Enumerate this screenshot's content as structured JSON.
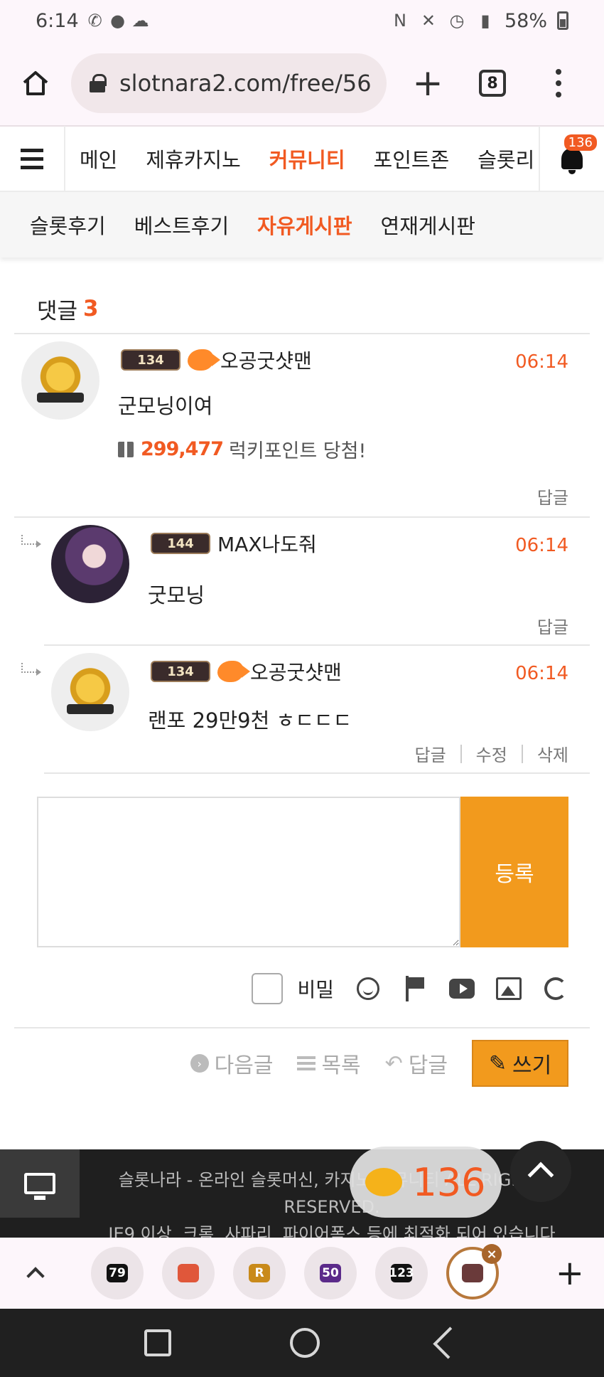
{
  "status_bar": {
    "time": "6:14",
    "battery": "58%"
  },
  "browser": {
    "url": "slotnara2.com/free/56",
    "tab_count": "8"
  },
  "site_nav": {
    "items": [
      {
        "label": "메인",
        "active": false
      },
      {
        "label": "제휴카지노",
        "active": false
      },
      {
        "label": "커뮤니티",
        "active": true
      },
      {
        "label": "포인트존",
        "active": false
      },
      {
        "label": "슬롯리",
        "active": false
      }
    ],
    "notification_count": "136"
  },
  "sub_nav": {
    "items": [
      {
        "label": "슬롯후기",
        "active": false
      },
      {
        "label": "베스트후기",
        "active": false
      },
      {
        "label": "자유게시판",
        "active": true
      },
      {
        "label": "연재게시판",
        "active": false
      }
    ]
  },
  "comments_section": {
    "title": "댓글",
    "count": "3",
    "comments": [
      {
        "level": "134",
        "username": "오공굿샷맨",
        "time": "06:14",
        "text": "군모닝이여",
        "lucky_points": "299,477",
        "lucky_suffix": "럭키포인트 당첨!",
        "reply_label": "답글"
      },
      {
        "level": "144",
        "username": "MAX나도줘",
        "time": "06:14",
        "text": "굿모닝",
        "reply_label": "답글"
      },
      {
        "level": "134",
        "username": "오공굿샷맨",
        "time": "06:14",
        "text": "랜포 29만9천 ㅎㄷㄷㄷ",
        "reply_label": "답글",
        "edit_label": "수정",
        "delete_label": "삭제"
      }
    ]
  },
  "write_form": {
    "submit_label": "등록",
    "secret_label": "비밀",
    "textarea_value": ""
  },
  "post_nav": {
    "next_label": "다음글",
    "list_label": "목록",
    "reply_label": "답글",
    "write_label": "쓰기"
  },
  "footer": {
    "line1": "슬롯나라 - 온라인 슬롯머신, 카지노 커뮤니티 ALL RIGHTS RESERVED.",
    "line2": "IE9 이상, 크롬, 사파리, 파이어폭스 등에 최적화 되어 있습니다"
  },
  "chat_bubble": {
    "count": "136"
  },
  "bottom_tabs": {
    "items": [
      "79",
      "",
      "R",
      "50",
      "123",
      ""
    ]
  },
  "colors": {
    "accent": "#f15a22",
    "button_orange": "#f29a1d",
    "footer_bg": "#1f1f1f"
  }
}
